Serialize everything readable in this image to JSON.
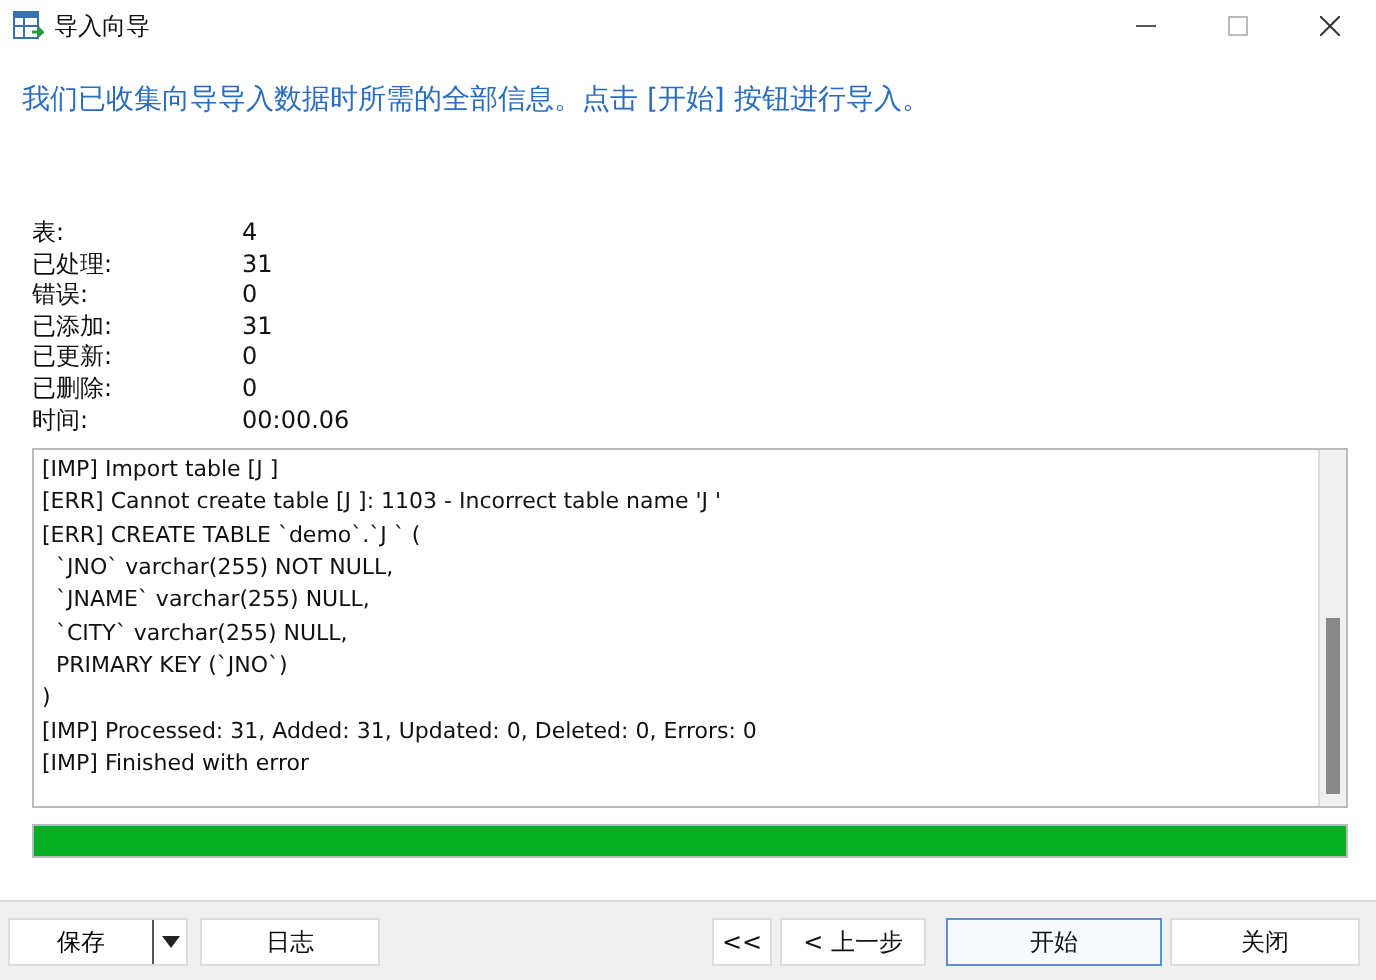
{
  "window": {
    "title": "导入向导"
  },
  "heading": "我们已收集向导导入数据时所需的全部信息。点击 [开始] 按钮进行导入。",
  "stats": [
    {
      "label": "表:",
      "value": "4"
    },
    {
      "label": "已处理:",
      "value": "31"
    },
    {
      "label": "错误:",
      "value": "0"
    },
    {
      "label": "已添加:",
      "value": "31"
    },
    {
      "label": "已更新:",
      "value": "0"
    },
    {
      "label": "已删除:",
      "value": "0"
    },
    {
      "label": "时间:",
      "value": "00:00.06"
    }
  ],
  "log": [
    "[IMP] Import table [J ]",
    "[ERR] Cannot create table [J ]: 1103 - Incorrect table name 'J '",
    "[ERR] CREATE TABLE `demo`.`J ` (",
    "  `JNO` varchar(255) NOT NULL,",
    "  `JNAME` varchar(255) NULL,",
    "  `CITY` varchar(255) NULL,",
    "  PRIMARY KEY (`JNO`)",
    ")",
    "[IMP] Processed: 31, Added: 31, Updated: 0, Deleted: 0, Errors: 0",
    "[IMP] Finished with error"
  ],
  "progress": {
    "level": 1.0
  },
  "buttons_left": [
    {
      "label": "保存",
      "kind": "split"
    },
    {
      "label": "日志",
      "kind": "plain"
    }
  ],
  "buttons_right": [
    {
      "label": "<<",
      "selected": false
    },
    {
      "label": "< 上一步",
      "selected": false
    },
    {
      "label": "开始",
      "selected": true
    },
    {
      "label": "关闭",
      "selected": false
    }
  ]
}
